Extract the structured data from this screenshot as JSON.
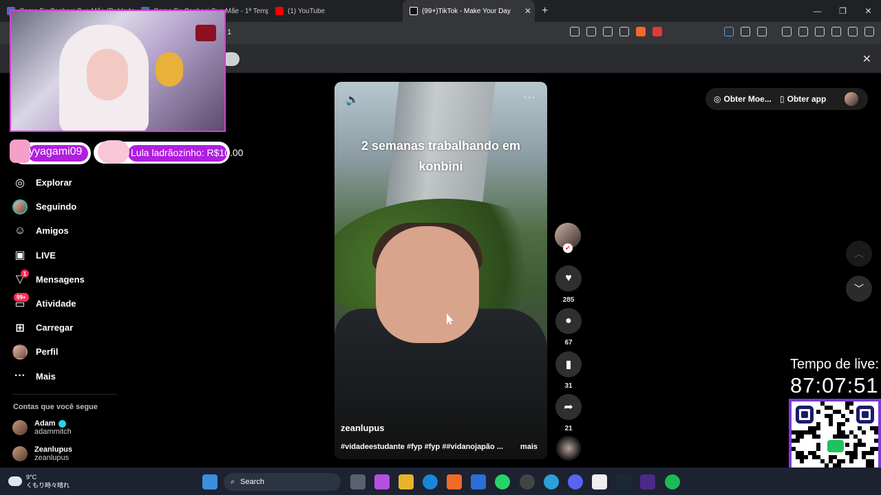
{
  "browser": {
    "tabs": [
      {
        "title": "Como Eu Conheci Sua Mãe (Dublado",
        "active": false,
        "favicon": "doc-icon"
      },
      {
        "title": "Como Eu Conheci Sua Mãe - 1ª Temp",
        "active": false,
        "favicon": "doc-icon"
      },
      {
        "title": "(1) YouTube",
        "active": false,
        "favicon": "youtube-icon"
      },
      {
        "title": "(99+)TikTok - Make Your Day",
        "active": true,
        "favicon": "tiktok-icon"
      }
    ],
    "new_tab": "+",
    "address_fragment": "1"
  },
  "overlay": {
    "username": "yyagami09",
    "donation": "Lula ladrãozinho: R$10.00",
    "live_label": "Tempo de live:",
    "live_time": "87:07:51"
  },
  "sidebar": {
    "items": [
      {
        "label": "Explorar",
        "icon": "compass-icon"
      },
      {
        "label": "Seguindo",
        "icon": "avatar"
      },
      {
        "label": "Amigos",
        "icon": "friends-icon"
      },
      {
        "label": "LIVE",
        "icon": "live-tv-icon"
      },
      {
        "label": "Mensagens",
        "icon": "inbox-icon",
        "badge": "1"
      },
      {
        "label": "Atividade",
        "icon": "activity-icon",
        "badge": "99+"
      },
      {
        "label": "Carregar",
        "icon": "upload-icon"
      },
      {
        "label": "Perfil",
        "icon": "avatar"
      },
      {
        "label": "Mais",
        "icon": "more-icon"
      }
    ],
    "following_title": "Contas que você segue",
    "following": [
      {
        "name": "Adam",
        "handle": "adammitch",
        "verified": true
      },
      {
        "name": "Zeanlupus",
        "handle": "zeanlupus",
        "verified": false
      }
    ]
  },
  "video": {
    "caption_line1": "2 semanas trabalhando em",
    "caption_line2": "konbini",
    "author": "zeanlupus",
    "tags": "#vidadeestudante #fyp #fyp ##vidanojapão ...",
    "more": "mais"
  },
  "actions": {
    "likes": "285",
    "comments": "67",
    "saves": "31",
    "shares": "21"
  },
  "header_right": {
    "coins": "Obter Moe...",
    "get_app": "Obter app"
  },
  "taskbar": {
    "weather_temp": "9°C",
    "weather_desc": "くもり時々晴れ",
    "search_placeholder": "Search"
  },
  "colors": {
    "accent": "#fe2c55",
    "badge_purple": "#b01ee0",
    "qr_border": "#7c3bd8",
    "webcam_border": "#d43fd0"
  }
}
